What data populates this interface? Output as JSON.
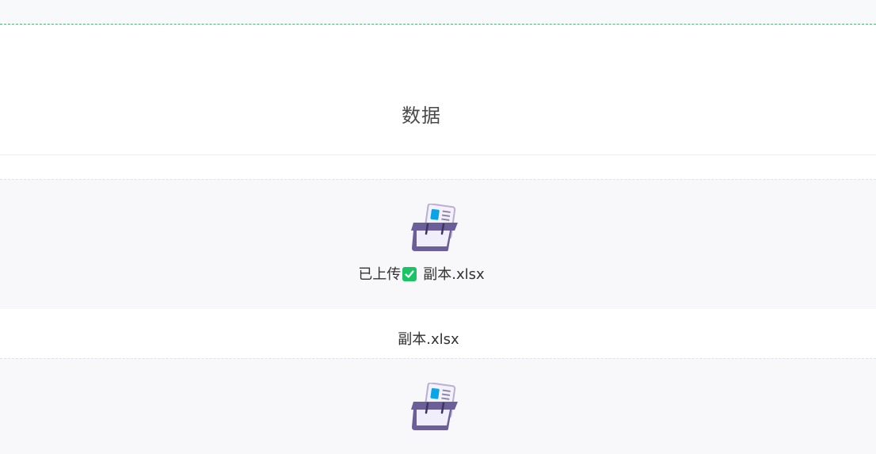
{
  "page": {
    "title": "数据"
  },
  "upload_1": {
    "status_label": "已上传",
    "status_icon": "check-icon",
    "filename": "副本.xlsx",
    "icon": "file-upload-tray-icon",
    "accent_color": "#19c463"
  },
  "file_row": {
    "filename": "副本.xlsx"
  },
  "upload_2": {
    "icon": "file-upload-tray-icon"
  },
  "colors": {
    "tray_purple": "#6a5f98",
    "doc_blue": "#0aa5e6",
    "panel_bg": "#f8f8fb"
  }
}
